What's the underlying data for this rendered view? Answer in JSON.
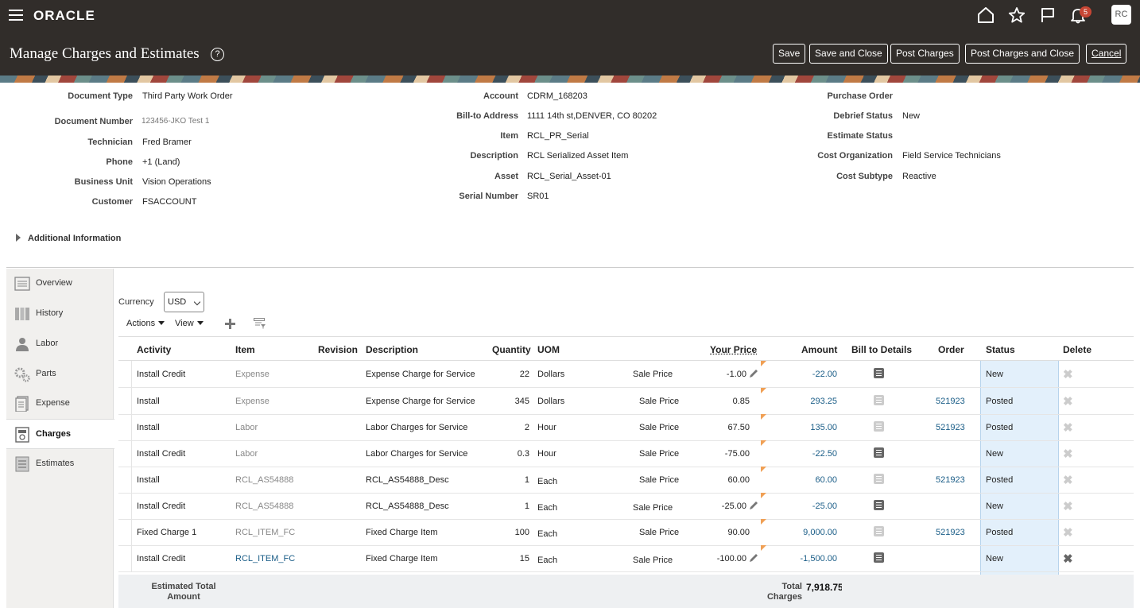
{
  "app": {
    "logo": "ORACLE",
    "notifications": "5",
    "user_initials": "RC"
  },
  "page": {
    "title": "Manage Charges and Estimates",
    "help": "?"
  },
  "toolbar": {
    "save": "Save",
    "save_close": "Save and Close",
    "post_charges": "Post Charges",
    "post_charges_close": "Post Charges and Close",
    "cancel": "Cancel"
  },
  "header": {
    "left": [
      {
        "label": "Document Type",
        "value": "Third Party Work Order"
      },
      {
        "label": "Document Number",
        "value": "123456-JKO Test 1"
      },
      {
        "label": "Technician",
        "value": "Fred Bramer"
      },
      {
        "label": "Phone",
        "value": "+1 (Land)"
      },
      {
        "label": "Business Unit",
        "value": "Vision Operations"
      },
      {
        "label": "Customer",
        "value": "FSACCOUNT"
      }
    ],
    "middle": [
      {
        "label": "Account",
        "value": "CDRM_168203"
      },
      {
        "label": "Bill-to Address",
        "value": "1111 14th st,DENVER, CO 80202"
      },
      {
        "label": "Item",
        "value": "RCL_PR_Serial"
      },
      {
        "label": "Description",
        "value": "RCL Serialized Asset Item"
      },
      {
        "label": "Asset",
        "value": "RCL_Serial_Asset-01"
      },
      {
        "label": "Serial Number",
        "value": "SR01"
      }
    ],
    "right": [
      {
        "label": "Purchase Order",
        "value": ""
      },
      {
        "label": "Debrief Status",
        "value": "New"
      },
      {
        "label": "Estimate Status",
        "value": ""
      },
      {
        "label": "Cost Organization",
        "value": "Field Service Technicians"
      },
      {
        "label": "Cost Subtype",
        "value": "Reactive"
      }
    ]
  },
  "additional_info": "Additional Information",
  "nav": [
    {
      "label": "Overview",
      "icon": "overview-icon"
    },
    {
      "label": "History",
      "icon": "history-icon"
    },
    {
      "label": "Labor",
      "icon": "labor-icon"
    },
    {
      "label": "Parts",
      "icon": "parts-icon"
    },
    {
      "label": "Expense",
      "icon": "expense-icon"
    },
    {
      "label": "Charges",
      "icon": "charges-icon",
      "active": true
    },
    {
      "label": "Estimates",
      "icon": "estimates-icon"
    }
  ],
  "currency": {
    "label": "Currency",
    "value": "USD"
  },
  "table_toolbar": {
    "actions": "Actions",
    "view": "View"
  },
  "table": {
    "columns": [
      "Activity",
      "Item",
      "Revision",
      "Description",
      "Quantity",
      "UOM",
      "Your Price",
      "Amount",
      "Bill to Details",
      "Order",
      "Status",
      "Delete"
    ],
    "rows": [
      {
        "activity": "Install Credit",
        "item": "Expense",
        "item_link": false,
        "description": "Expense Charge for Service",
        "quantity": "22",
        "uom": "Dollars",
        "price_type": "Sale Price",
        "price": "-1.00",
        "editable": true,
        "amount": "-22.00",
        "bill_active": true,
        "order": "",
        "status": "New",
        "delete_active": false
      },
      {
        "activity": "Install",
        "item": "Expense",
        "item_link": false,
        "description": "Expense Charge for Service",
        "quantity": "345",
        "uom": "Dollars",
        "price_type": "Sale Price",
        "price": "0.85",
        "editable": false,
        "amount": "293.25",
        "bill_active": false,
        "order": "521923",
        "status": "Posted",
        "delete_active": false
      },
      {
        "activity": "Install",
        "item": "Labor",
        "item_link": false,
        "description": "Labor Charges for Service",
        "quantity": "2",
        "uom": "Hour",
        "price_type": "Sale Price",
        "price": "67.50",
        "editable": false,
        "amount": "135.00",
        "bill_active": false,
        "order": "521923",
        "status": "Posted",
        "delete_active": false
      },
      {
        "activity": "Install Credit",
        "item": "Labor",
        "item_link": false,
        "description": "Labor Charges for Service",
        "quantity": "0.3",
        "uom": "Hour",
        "price_type": "Sale Price",
        "price": "-75.00",
        "editable": false,
        "amount": "-22.50",
        "bill_active": true,
        "order": "",
        "status": "New",
        "delete_active": false
      },
      {
        "activity": "Install",
        "item": "RCL_AS54888",
        "item_link": false,
        "description": "RCL_AS54888_Desc",
        "quantity": "1",
        "uom": "Each",
        "price_type": "Sale Price",
        "price": "60.00",
        "editable": false,
        "amount": "60.00",
        "bill_active": false,
        "order": "521923",
        "status": "Posted",
        "delete_active": false
      },
      {
        "activity": "Install Credit",
        "item": "RCL_AS54888",
        "item_link": false,
        "description": "RCL_AS54888_Desc",
        "quantity": "1",
        "uom": "Each",
        "price_type": "Sale Price",
        "price": "-25.00",
        "editable": true,
        "amount": "-25.00",
        "bill_active": true,
        "order": "",
        "status": "New",
        "delete_active": false
      },
      {
        "activity": "Fixed Charge 1",
        "item": "RCL_ITEM_FC",
        "item_link": false,
        "description": "Fixed Charge Item",
        "quantity": "100",
        "uom": "Each",
        "price_type": "Sale Price",
        "price": "90.00",
        "editable": false,
        "amount": "9,000.00",
        "bill_active": false,
        "order": "521923",
        "status": "Posted",
        "delete_active": false
      },
      {
        "activity": "Install Credit",
        "item": "RCL_ITEM_FC",
        "item_link": true,
        "description": "Fixed Charge Item",
        "quantity": "15",
        "uom": "Each",
        "price_type": "Sale Price",
        "price": "-100.00",
        "editable": true,
        "amount": "-1,500.00",
        "bill_active": true,
        "order": "",
        "status": "New",
        "delete_active": true
      }
    ]
  },
  "footer": {
    "estimated_label_1": "Estimated Total",
    "estimated_label_2": "Amount",
    "total_label_1": "Total",
    "total_label_2": "Charges",
    "total_value": "7,918.75"
  }
}
